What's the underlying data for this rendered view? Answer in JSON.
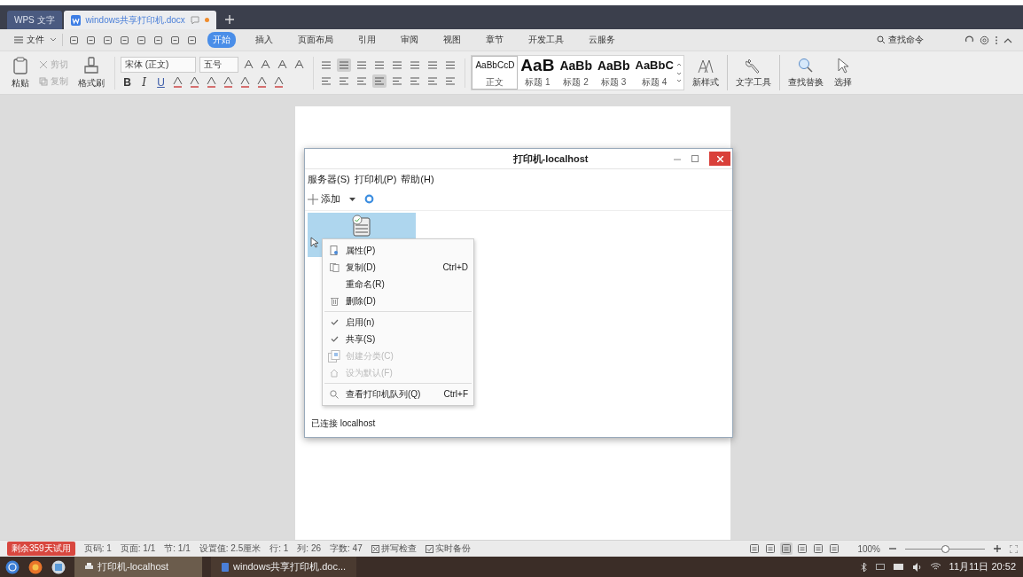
{
  "app_tabs": [
    {
      "label": "WPS 文字",
      "kind": "app",
      "selected": false,
      "modified": false
    },
    {
      "label": "windows共享打印机.docx",
      "kind": "doc",
      "selected": true,
      "modified": true
    }
  ],
  "menu": {
    "file": "文件",
    "tabs": [
      {
        "label": "开始",
        "selected": true
      },
      {
        "label": "插入",
        "selected": false
      },
      {
        "label": "页面布局",
        "selected": false
      },
      {
        "label": "引用",
        "selected": false
      },
      {
        "label": "审阅",
        "selected": false
      },
      {
        "label": "视图",
        "selected": false
      },
      {
        "label": "章节",
        "selected": false
      },
      {
        "label": "开发工具",
        "selected": false
      },
      {
        "label": "云服务",
        "selected": false
      }
    ],
    "command_search": "查找命令"
  },
  "ribbon": {
    "paste": "粘贴",
    "cut": "剪切",
    "copy": "复制",
    "format_painter": "格式刷",
    "font_family": "宋体 (正文)",
    "font_size": "五号",
    "bold": "B",
    "italic": "I",
    "underline": "U",
    "styles": [
      {
        "sample": "AaBbCcD",
        "label": "正文",
        "kind": "body",
        "selected": true
      },
      {
        "sample": "AaB",
        "label": "标题 1",
        "kind": "h1",
        "selected": false
      },
      {
        "sample": "AaBb",
        "label": "标题 2",
        "kind": "h2",
        "selected": false
      },
      {
        "sample": "AaBb",
        "label": "标题 3",
        "kind": "h3",
        "selected": false
      },
      {
        "sample": "AaBbC",
        "label": "标题 4",
        "kind": "h4",
        "selected": false
      }
    ],
    "new_style": "新样式",
    "text_tools": "文字工具",
    "find_replace": "查找替换",
    "select": "选择"
  },
  "dialog": {
    "title": "打印机-localhost",
    "menus": [
      "服务器(S)",
      "打印机(P)",
      "帮助(H)"
    ],
    "add": "添加",
    "printer_selected": true,
    "context_menu": [
      {
        "items": [
          {
            "label": "属性(P)",
            "kind": "properties",
            "disabled": false
          },
          {
            "label": "复制(D)",
            "shortcut": "Ctrl+D",
            "kind": "copy",
            "disabled": false
          },
          {
            "label": "重命名(R)",
            "kind": "rename",
            "disabled": false
          },
          {
            "label": "删除(D)",
            "kind": "delete",
            "disabled": false
          }
        ]
      },
      {
        "items": [
          {
            "label": "启用(n)",
            "kind": "toggle",
            "checked": true,
            "disabled": false
          },
          {
            "label": "共享(S)",
            "kind": "toggle",
            "checked": true,
            "disabled": false
          },
          {
            "label": "创建分类(C)",
            "kind": "class",
            "disabled": true
          },
          {
            "label": "设为默认(F)",
            "kind": "default",
            "disabled": true
          }
        ]
      },
      {
        "items": [
          {
            "label": "查看打印机队列(Q)",
            "shortcut": "Ctrl+F",
            "kind": "queue",
            "disabled": false
          }
        ]
      }
    ],
    "status": "已连接 localhost"
  },
  "status_bar": {
    "trial": "剩余359天试用",
    "items": [
      "页码: 1",
      "页面: 1/1",
      "节: 1/1",
      "设置值: 2.5厘米",
      "行: 1",
      "列: 26",
      "字数: 47"
    ],
    "spell": "拼写检查",
    "backup": "实时备份",
    "zoom": "100%",
    "zoom_slider": {
      "level": 0.5
    }
  },
  "taskbar": {
    "windows": [
      {
        "label": "打印机-localhost",
        "kind": "printer",
        "selected": true
      },
      {
        "label": "windows共享打印机.doc...",
        "kind": "doc",
        "selected": false
      }
    ],
    "clock": "11月11日 20:52"
  }
}
